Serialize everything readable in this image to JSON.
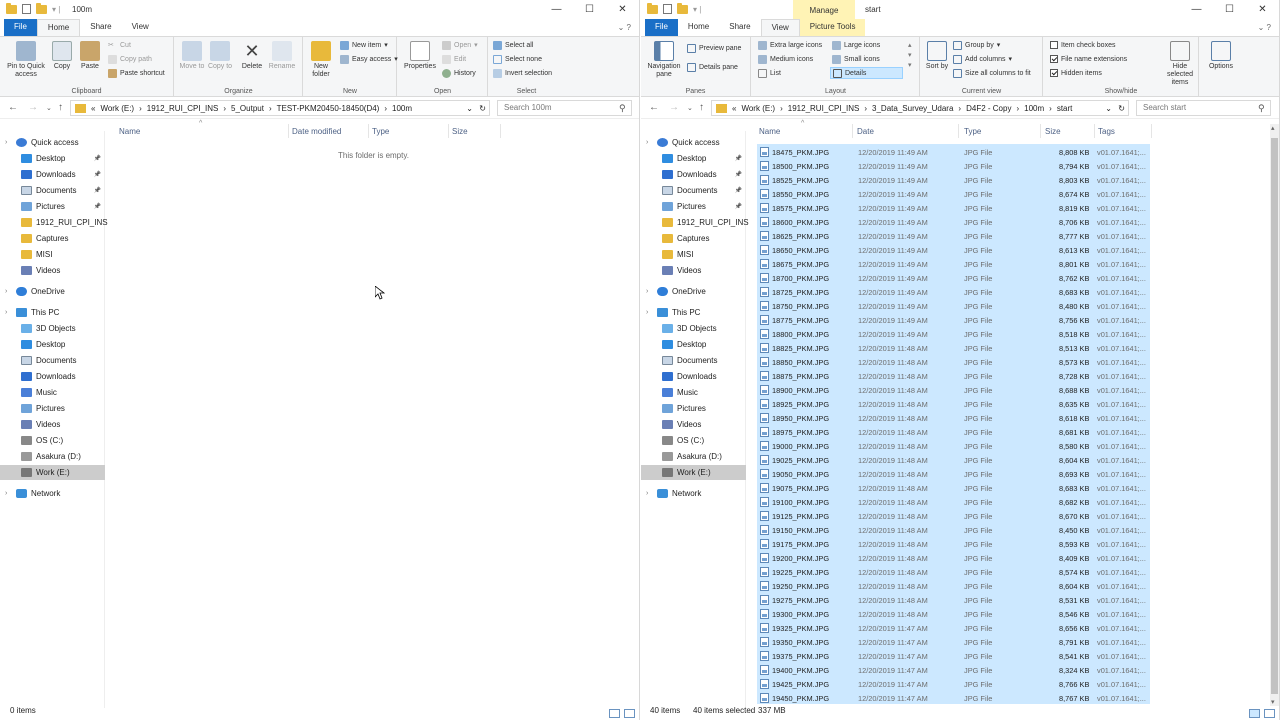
{
  "left": {
    "title": "100m",
    "tabs": {
      "file": "File",
      "home": "Home",
      "share": "Share",
      "view": "View"
    },
    "ribbon": {
      "pin": "Pin to Quick access",
      "copy": "Copy",
      "paste": "Paste",
      "cut": "Cut",
      "copy_path": "Copy path",
      "paste_shortcut": "Paste shortcut",
      "clipboard": "Clipboard",
      "move_to": "Move to",
      "copy_to": "Copy to",
      "delete": "Delete",
      "rename": "Rename",
      "organize": "Organize",
      "new_folder": "New folder",
      "new_item": "New item",
      "easy_access": "Easy access",
      "new": "New",
      "properties": "Properties",
      "open": "Open",
      "edit": "Edit",
      "history": "History",
      "open_group": "Open",
      "select_all": "Select all",
      "select_none": "Select none",
      "invert": "Invert selection",
      "select": "Select"
    },
    "address": [
      "Work (E:)",
      "1912_RUI_CPI_INS",
      "5_Output",
      "TEST-PKM20450-18450(D4)",
      "100m"
    ],
    "search_placeholder": "Search 100m",
    "columns": {
      "name": "Name",
      "date": "Date modified",
      "type": "Type",
      "size": "Size"
    },
    "empty_text": "This folder is empty.",
    "status": "0 items"
  },
  "right": {
    "title": "start",
    "manage": "Manage",
    "picture_tools": "Picture Tools",
    "tabs": {
      "file": "File",
      "home": "Home",
      "share": "Share",
      "view": "View"
    },
    "ribbon": {
      "nav_pane": "Navigation pane",
      "preview_pane": "Preview pane",
      "details_pane": "Details pane",
      "panes": "Panes",
      "extra_large": "Extra large icons",
      "large": "Large icons",
      "medium": "Medium icons",
      "small": "Small icons",
      "list": "List",
      "details": "Details",
      "layout": "Layout",
      "sort_by": "Sort by",
      "group_by": "Group by",
      "add_columns": "Add columns",
      "size_all": "Size all columns to fit",
      "current_view": "Current view",
      "item_check": "Item check boxes",
      "file_ext": "File name extensions",
      "hidden": "Hidden items",
      "hide_selected": "Hide selected items",
      "options": "Options",
      "show_hide": "Show/hide"
    },
    "address": [
      "Work (E:)",
      "1912_RUI_CPI_INS",
      "3_Data_Survey_Udara",
      "D4F2 - Copy",
      "100m",
      "start"
    ],
    "search_placeholder": "Search start",
    "columns": {
      "name": "Name",
      "date": "Date",
      "type": "Type",
      "size": "Size",
      "tags": "Tags"
    },
    "files": [
      {
        "name": "18475_PKM.JPG",
        "date": "12/20/2019 11:49 AM",
        "size": "8,808 KB"
      },
      {
        "name": "18500_PKM.JPG",
        "date": "12/20/2019 11:49 AM",
        "size": "8,794 KB"
      },
      {
        "name": "18525_PKM.JPG",
        "date": "12/20/2019 11:49 AM",
        "size": "8,803 KB"
      },
      {
        "name": "18550_PKM.JPG",
        "date": "12/20/2019 11:49 AM",
        "size": "8,674 KB"
      },
      {
        "name": "18575_PKM.JPG",
        "date": "12/20/2019 11:49 AM",
        "size": "8,819 KB"
      },
      {
        "name": "18600_PKM.JPG",
        "date": "12/20/2019 11:49 AM",
        "size": "8,706 KB"
      },
      {
        "name": "18625_PKM.JPG",
        "date": "12/20/2019 11:49 AM",
        "size": "8,777 KB"
      },
      {
        "name": "18650_PKM.JPG",
        "date": "12/20/2019 11:49 AM",
        "size": "8,613 KB"
      },
      {
        "name": "18675_PKM.JPG",
        "date": "12/20/2019 11:49 AM",
        "size": "8,801 KB"
      },
      {
        "name": "18700_PKM.JPG",
        "date": "12/20/2019 11:49 AM",
        "size": "8,762 KB"
      },
      {
        "name": "18725_PKM.JPG",
        "date": "12/20/2019 11:49 AM",
        "size": "8,683 KB"
      },
      {
        "name": "18750_PKM.JPG",
        "date": "12/20/2019 11:49 AM",
        "size": "8,480 KB"
      },
      {
        "name": "18775_PKM.JPG",
        "date": "12/20/2019 11:49 AM",
        "size": "8,756 KB"
      },
      {
        "name": "18800_PKM.JPG",
        "date": "12/20/2019 11:49 AM",
        "size": "8,518 KB"
      },
      {
        "name": "18825_PKM.JPG",
        "date": "12/20/2019 11:48 AM",
        "size": "8,513 KB"
      },
      {
        "name": "18850_PKM.JPG",
        "date": "12/20/2019 11:48 AM",
        "size": "8,573 KB"
      },
      {
        "name": "18875_PKM.JPG",
        "date": "12/20/2019 11:48 AM",
        "size": "8,728 KB"
      },
      {
        "name": "18900_PKM.JPG",
        "date": "12/20/2019 11:48 AM",
        "size": "8,688 KB"
      },
      {
        "name": "18925_PKM.JPG",
        "date": "12/20/2019 11:48 AM",
        "size": "8,635 KB"
      },
      {
        "name": "18950_PKM.JPG",
        "date": "12/20/2019 11:48 AM",
        "size": "8,618 KB"
      },
      {
        "name": "18975_PKM.JPG",
        "date": "12/20/2019 11:48 AM",
        "size": "8,681 KB"
      },
      {
        "name": "19000_PKM.JPG",
        "date": "12/20/2019 11:48 AM",
        "size": "8,580 KB"
      },
      {
        "name": "19025_PKM.JPG",
        "date": "12/20/2019 11:48 AM",
        "size": "8,604 KB"
      },
      {
        "name": "19050_PKM.JPG",
        "date": "12/20/2019 11:48 AM",
        "size": "8,693 KB"
      },
      {
        "name": "19075_PKM.JPG",
        "date": "12/20/2019 11:48 AM",
        "size": "8,683 KB"
      },
      {
        "name": "19100_PKM.JPG",
        "date": "12/20/2019 11:48 AM",
        "size": "8,682 KB"
      },
      {
        "name": "19125_PKM.JPG",
        "date": "12/20/2019 11:48 AM",
        "size": "8,670 KB"
      },
      {
        "name": "19150_PKM.JPG",
        "date": "12/20/2019 11:48 AM",
        "size": "8,450 KB"
      },
      {
        "name": "19175_PKM.JPG",
        "date": "12/20/2019 11:48 AM",
        "size": "8,593 KB"
      },
      {
        "name": "19200_PKM.JPG",
        "date": "12/20/2019 11:48 AM",
        "size": "8,409 KB"
      },
      {
        "name": "19225_PKM.JPG",
        "date": "12/20/2019 11:48 AM",
        "size": "8,574 KB"
      },
      {
        "name": "19250_PKM.JPG",
        "date": "12/20/2019 11:48 AM",
        "size": "8,604 KB"
      },
      {
        "name": "19275_PKM.JPG",
        "date": "12/20/2019 11:48 AM",
        "size": "8,531 KB"
      },
      {
        "name": "19300_PKM.JPG",
        "date": "12/20/2019 11:48 AM",
        "size": "8,546 KB"
      },
      {
        "name": "19325_PKM.JPG",
        "date": "12/20/2019 11:47 AM",
        "size": "8,656 KB"
      },
      {
        "name": "19350_PKM.JPG",
        "date": "12/20/2019 11:47 AM",
        "size": "8,791 KB"
      },
      {
        "name": "19375_PKM.JPG",
        "date": "12/20/2019 11:47 AM",
        "size": "8,541 KB"
      },
      {
        "name": "19400_PKM.JPG",
        "date": "12/20/2019 11:47 AM",
        "size": "8,324 KB"
      },
      {
        "name": "19425_PKM.JPG",
        "date": "12/20/2019 11:47 AM",
        "size": "8,766 KB"
      },
      {
        "name": "19450_PKM.JPG",
        "date": "12/20/2019 11:47 AM",
        "size": "8,767 KB"
      }
    ],
    "file_type": "JPG File",
    "file_tag": "v01.07.1641;...",
    "status_items": "40 items",
    "status_selected": "40 items selected",
    "status_size": "337 MB"
  },
  "nav": {
    "quick_access": "Quick access",
    "quick_items": [
      "Desktop",
      "Downloads",
      "Documents",
      "Pictures",
      "1912_RUI_CPI_INS",
      "Captures",
      "MISI",
      "Videos"
    ],
    "onedrive": "OneDrive",
    "this_pc": "This PC",
    "pc_items": [
      "3D Objects",
      "Desktop",
      "Documents",
      "Downloads",
      "Music",
      "Pictures",
      "Videos",
      "OS (C:)",
      "Asakura (D:)",
      "Work (E:)"
    ],
    "network": "Network"
  },
  "colors": {
    "accent": "#1a6fc7",
    "selection": "#cce8ff",
    "folder": "#e8b93b",
    "context_tab": "#fff3b5"
  }
}
